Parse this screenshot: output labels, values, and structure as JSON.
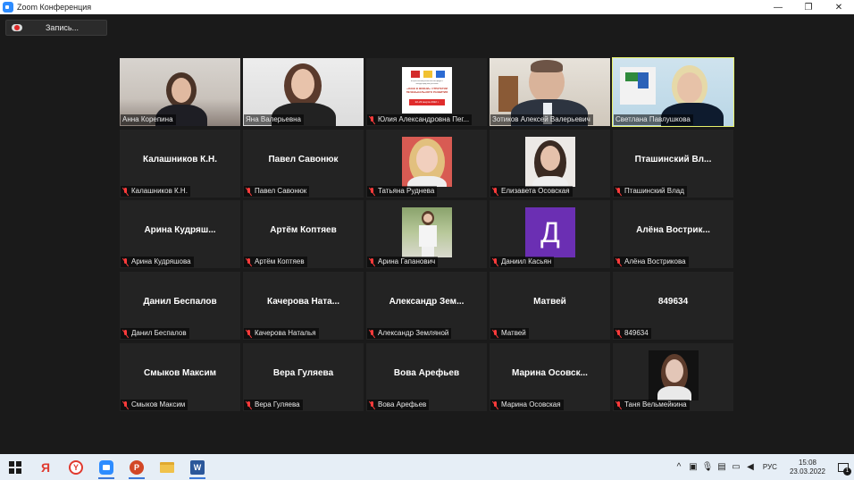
{
  "window": {
    "title": "Zoom Конференция",
    "controls": {
      "minimize": "—",
      "restore": "❐",
      "close": "✕"
    }
  },
  "toolbar": {
    "record_label": "Запись..."
  },
  "participants": [
    {
      "name": "Анна Корепина",
      "kind": "video",
      "muted": false
    },
    {
      "name": "Яна Валерьевна",
      "kind": "video",
      "muted": false
    },
    {
      "name": "Юлия Александровна Пег...",
      "kind": "slide",
      "muted": true
    },
    {
      "name": "Зотиков Алексей Валерьевич",
      "kind": "video",
      "muted": false
    },
    {
      "name": "Светлана Павлушкова",
      "kind": "video",
      "muted": false,
      "active_speaker": true
    },
    {
      "name": "Калашников К.Н.",
      "display": "Калашников К.Н.",
      "kind": "name",
      "muted": true
    },
    {
      "name": "Павел Савонюк",
      "display": "Павел Савонюк",
      "kind": "name",
      "muted": true
    },
    {
      "name": "Татьяна Руднева",
      "kind": "thumb",
      "muted": true
    },
    {
      "name": "Елизавета Осовская",
      "kind": "thumb",
      "muted": true
    },
    {
      "name": "Пташинский Влад",
      "display": "Пташинский  Вл...",
      "kind": "name",
      "muted": true
    },
    {
      "name": "Арина Кудряшова",
      "display": "Арина  Кудряш...",
      "kind": "name",
      "muted": true
    },
    {
      "name": "Артём Коптяев",
      "display": "Артём Коптяев",
      "kind": "name",
      "muted": true
    },
    {
      "name": "Арина Гапанович",
      "kind": "thumb",
      "muted": true
    },
    {
      "name": "Даниил Касьян",
      "kind": "avatar",
      "avatar_letter": "Д",
      "avatar_color": "#6b2fb3",
      "muted": true
    },
    {
      "name": "Алёна Вострикова",
      "display": "Алёна  Вострик...",
      "kind": "name",
      "muted": true
    },
    {
      "name": "Данил Беспалов",
      "display": "Данил Беспалов",
      "kind": "name",
      "muted": true
    },
    {
      "name": "Качерова Наталья",
      "display": "Качерова  Ната...",
      "kind": "name",
      "muted": true
    },
    {
      "name": "Александр Земляной",
      "display": "Александр  Зем...",
      "kind": "name",
      "muted": true
    },
    {
      "name": "Матвей",
      "display": "Матвей",
      "kind": "name",
      "muted": true
    },
    {
      "name": "849634",
      "display": "849634",
      "kind": "name",
      "muted": true
    },
    {
      "name": "Смыков Максим",
      "display": "Смыков Максим",
      "kind": "name",
      "muted": true
    },
    {
      "name": "Вера Гуляева",
      "display": "Вера Гуляева",
      "kind": "name",
      "muted": true
    },
    {
      "name": "Вова Арефьев",
      "display": "Вова Арефьев",
      "kind": "name",
      "muted": true
    },
    {
      "name": "Марина Осовская",
      "display": "Марина  Осовск...",
      "kind": "name",
      "muted": true
    },
    {
      "name": "Таня Вельмейкина",
      "kind": "thumb",
      "muted": true
    }
  ],
  "slide": {
    "header": "Всероссийский региональный форум с международным участием",
    "title": "«ЗНАЕ В ЖИЗНИ»: СТРАТЕГИИ ПЕЧЕНЬКАЛЬНОГО РАЗВИТИЯ",
    "date": "22-23 марта 2022 г."
  },
  "taskbar": {
    "apps": [
      "windows-start",
      "yandex",
      "yandex-browser",
      "zoom",
      "powerpoint",
      "file-explorer",
      "word"
    ],
    "language": "РУС",
    "time": "15:08",
    "date": "23.03.2022",
    "notifications_count": "1"
  },
  "colors": {
    "tile_bg": "#232323",
    "active_border": "#e6f06a",
    "mute_red": "#ff3b3b",
    "avatar_purple": "#6b2fb3"
  }
}
